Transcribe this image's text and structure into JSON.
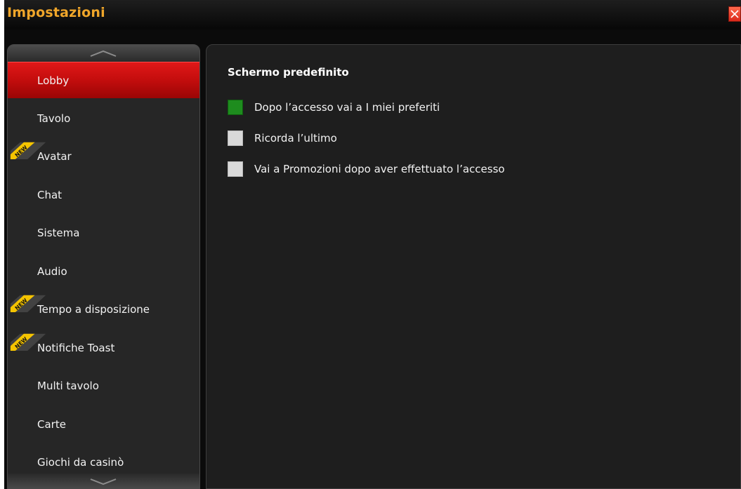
{
  "window": {
    "title": "Impostazioni"
  },
  "sidebar": {
    "items": [
      {
        "label": "Lobby",
        "active": true,
        "new": false
      },
      {
        "label": "Tavolo",
        "active": false,
        "new": false
      },
      {
        "label": "Avatar",
        "active": false,
        "new": true
      },
      {
        "label": "Chat",
        "active": false,
        "new": false
      },
      {
        "label": "Sistema",
        "active": false,
        "new": false
      },
      {
        "label": "Audio",
        "active": false,
        "new": false
      },
      {
        "label": "Tempo a disposizione",
        "active": false,
        "new": true
      },
      {
        "label": "Notifiche Toast",
        "active": false,
        "new": true
      },
      {
        "label": "Multi tavolo",
        "active": false,
        "new": false
      },
      {
        "label": "Carte",
        "active": false,
        "new": false
      },
      {
        "label": "Giochi da casinò",
        "active": false,
        "new": false
      }
    ],
    "badge_text": "NEW"
  },
  "content": {
    "section_title": "Schermo predefinito",
    "options": [
      {
        "label": "Dopo l’accesso vai a I miei preferiti",
        "checked": true
      },
      {
        "label": "Ricorda l’ultimo",
        "checked": false
      },
      {
        "label": "Vai a Promozioni dopo aver effettuato l’accesso",
        "checked": false
      }
    ]
  },
  "colors": {
    "title": "#f0a62a",
    "active_item": "#cc1010",
    "checked": "#1e8c1e",
    "badge": "#f5c400"
  }
}
